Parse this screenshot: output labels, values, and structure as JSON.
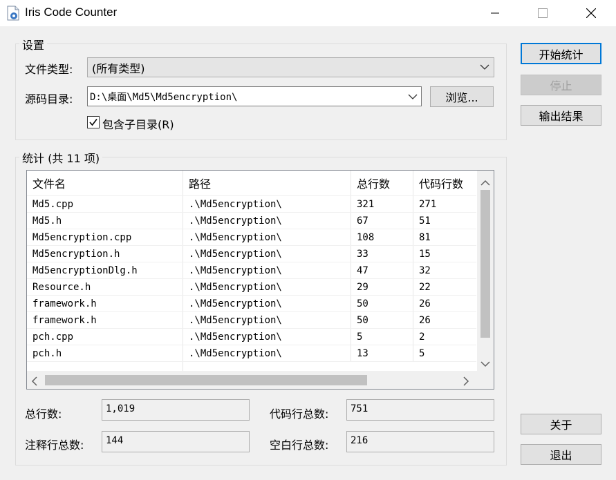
{
  "window": {
    "title": "Iris Code Counter"
  },
  "settings": {
    "legend": "设置",
    "file_type_label": "文件类型:",
    "file_type_value": "(所有类型)",
    "source_dir_label": "源码目录:",
    "source_dir_value": "D:\\桌面\\Md5\\Md5encryption\\",
    "browse_label": "浏览...",
    "include_subdirs_label": "包含子目录(R)",
    "include_subdirs_checked": true
  },
  "buttons": {
    "start": "开始统计",
    "stop": "停止",
    "export": "输出结果",
    "about": "关于",
    "exit": "退出"
  },
  "stats": {
    "legend": "统计 (共 11 项)",
    "columns": [
      "文件名",
      "路径",
      "总行数",
      "代码行数"
    ],
    "rows": [
      {
        "name": "Md5.cpp",
        "path": ".\\Md5encryption\\",
        "total": "321",
        "code": "271"
      },
      {
        "name": "Md5.h",
        "path": ".\\Md5encryption\\",
        "total": "67",
        "code": "51"
      },
      {
        "name": "Md5encryption.cpp",
        "path": ".\\Md5encryption\\",
        "total": "108",
        "code": "81"
      },
      {
        "name": "Md5encryption.h",
        "path": ".\\Md5encryption\\",
        "total": "33",
        "code": "15"
      },
      {
        "name": "Md5encryptionDlg.h",
        "path": ".\\Md5encryption\\",
        "total": "47",
        "code": "32"
      },
      {
        "name": "Resource.h",
        "path": ".\\Md5encryption\\",
        "total": "29",
        "code": "22"
      },
      {
        "name": "framework.h",
        "path": ".\\Md5encryption\\",
        "total": "50",
        "code": "26"
      },
      {
        "name": "framework.h",
        "path": ".\\Md5encryption\\",
        "total": "50",
        "code": "26"
      },
      {
        "name": "pch.cpp",
        "path": ".\\Md5encryption\\",
        "total": "5",
        "code": "2"
      },
      {
        "name": "pch.h",
        "path": ".\\Md5encryption\\",
        "total": "13",
        "code": "5"
      }
    ]
  },
  "totals": {
    "total_lines_label": "总行数:",
    "total_lines_value": "1,019",
    "code_lines_label": "代码行总数:",
    "code_lines_value": "751",
    "comment_lines_label": "注释行总数:",
    "comment_lines_value": "144",
    "blank_lines_label": "空白行总数:",
    "blank_lines_value": "216"
  }
}
